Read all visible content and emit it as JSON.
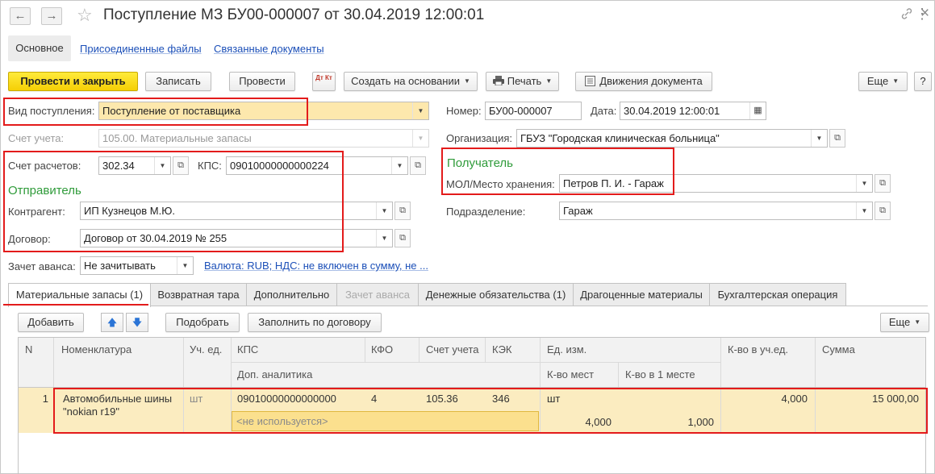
{
  "window": {
    "title": "Поступление МЗ БУ00-000007 от 30.04.2019 12:00:01",
    "back": "←",
    "forward": "→",
    "star": "☆",
    "link_glyph": "🔗",
    "more_glyph": "⋮",
    "close_glyph": "×"
  },
  "top_tabs": {
    "main": "Основное",
    "attached_files": "Присоединенные файлы",
    "related_docs": "Связанные документы"
  },
  "toolbar": {
    "post_and_close": "Провести и закрыть",
    "save": "Записать",
    "post": "Провести",
    "dt_kt": "Дт Кт",
    "create_based_on": "Создать на основании",
    "print": "Печать",
    "movements": "Движения документа",
    "more": "Еще",
    "help": "?"
  },
  "form": {
    "receipt_type_label": "Вид поступления:",
    "receipt_type_value": "Поступление от поставщика",
    "account_label": "Счет учета:",
    "account_value": "105.00. Материальные запасы",
    "settlement_label": "Счет расчетов:",
    "settlement_value": "302.34",
    "kps_label": "КПС:",
    "kps_value": "09010000000000224",
    "sender_heading": "Отправитель",
    "counterparty_label": "Контрагент:",
    "counterparty_value": "ИП Кузнецов М.Ю.",
    "contract_label": "Договор:",
    "contract_value": "Договор от 30.04.2019 № 255",
    "advance_label": "Зачет аванса:",
    "advance_value": "Не зачитывать",
    "currency_link": "Валюта: RUB; НДС: не включен в сумму, не ...",
    "number_label": "Номер:",
    "number_value": "БУ00-000007",
    "date_label": "Дата:",
    "date_value": "30.04.2019 12:00:01",
    "org_label": "Организация:",
    "org_value": "ГБУЗ \"Городская клиническая больница\"",
    "recipient_heading": "Получатель",
    "mol_label": "МОЛ/Место хранения:",
    "mol_value": "Петров П. И. - Гараж",
    "division_label": "Подразделение:",
    "division_value": "Гараж"
  },
  "tabs": [
    {
      "label": "Материальные запасы (1)"
    },
    {
      "label": "Возвратная тара"
    },
    {
      "label": "Дополнительно"
    },
    {
      "label": "Зачет аванса"
    },
    {
      "label": "Денежные обязательства (1)"
    },
    {
      "label": "Драгоценные материалы"
    },
    {
      "label": "Бухгалтерская операция"
    }
  ],
  "table_toolbar": {
    "add": "Добавить",
    "up": "🡅",
    "down": "🡇",
    "pick": "Подобрать",
    "fill_by_contract": "Заполнить по договору",
    "more": "Еще"
  },
  "table": {
    "headers": {
      "n": "N",
      "nomenclature": "Номенклатура",
      "unit": "Уч. ед.",
      "kps": "КПС",
      "kfo": "КФО",
      "account": "Счет учета",
      "kek": "КЭК",
      "measure": "Ед. изм.",
      "qty_unit": "К-во в уч.ед.",
      "sum": "Сумма",
      "extra_analytics": "Доп. аналитика",
      "places": "К-во мест",
      "per_place": "К-во в 1 месте"
    },
    "rows": [
      {
        "n": "1",
        "nomenclature_line1": "Автомобильные шины",
        "nomenclature_line2": "\"nokian r19\"",
        "unit": "шт",
        "kps": "09010000000000000",
        "kfo": "4",
        "account": "105.36",
        "kek": "346",
        "measure": "шт",
        "qty_unit": "4,000",
        "sum": "15 000,00",
        "extra_analytics": "<не используется>",
        "places": "4,000",
        "per_place": "1,000"
      }
    ]
  },
  "colors": {
    "accent_yellow": "#f5cf05",
    "highlight_red": "#e31b1b",
    "heading_green": "#2f9b3a",
    "link_blue": "#1b4fb8",
    "selected_row": "#fbecc0"
  }
}
